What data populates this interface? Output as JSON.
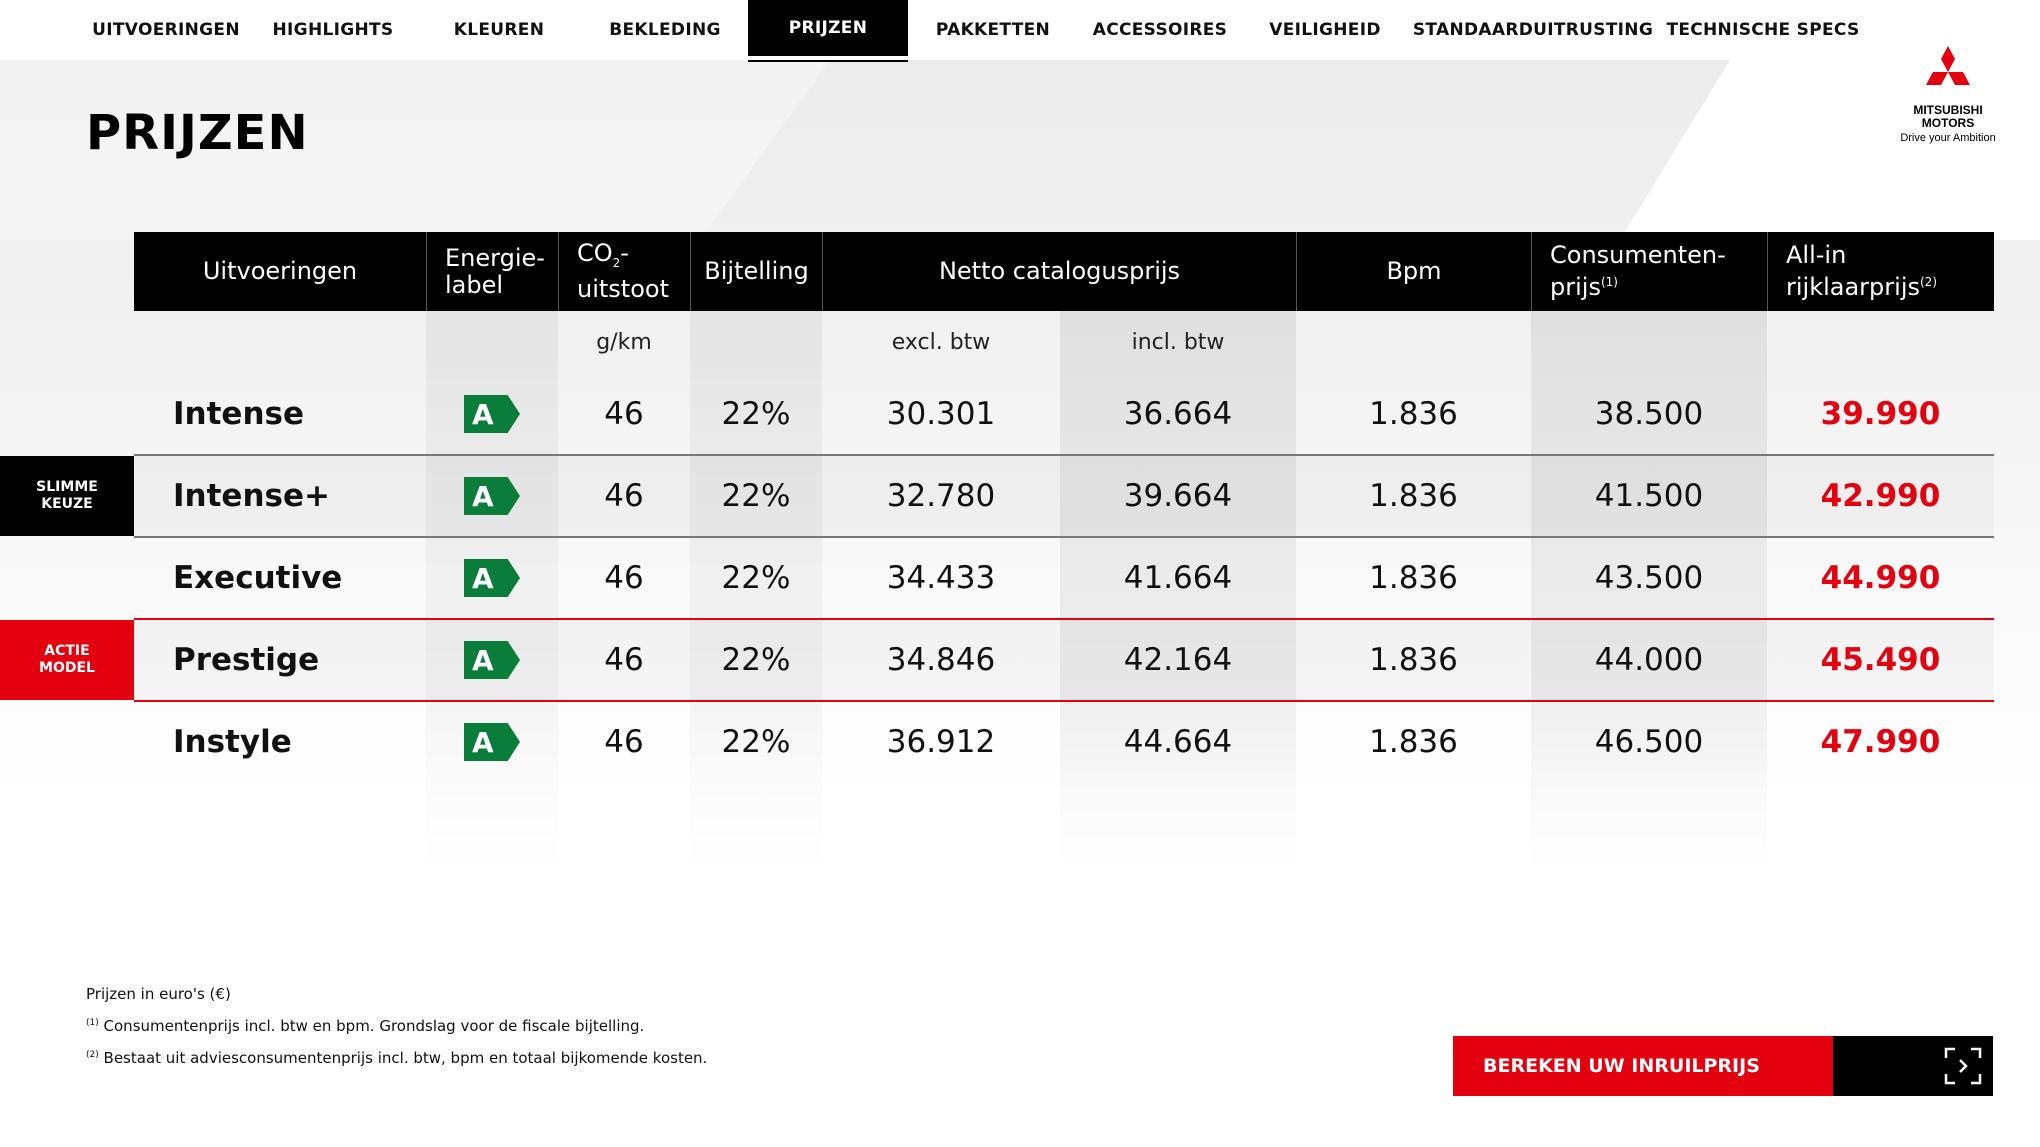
{
  "nav": [
    {
      "label": "UITVOERINGEN"
    },
    {
      "label": "HIGHLIGHTS"
    },
    {
      "label": "KLEUREN"
    },
    {
      "label": "BEKLEDING"
    },
    {
      "label": "PRIJZEN"
    },
    {
      "label": "PAKKETTEN"
    },
    {
      "label": "ACCESSOIRES"
    },
    {
      "label": "VEILIGHEID"
    },
    {
      "label": "STANDAARDUITRUSTING"
    },
    {
      "label": "TECHNISCHE SPECS"
    }
  ],
  "nav_active": "PRIJZEN",
  "logo": {
    "line1": "MITSUBISHI",
    "line2": "MOTORS",
    "tagline": "Drive your Ambition",
    "icon": "three-diamonds-icon",
    "color": "#e3000f"
  },
  "page_title": "PRIJZEN",
  "table": {
    "headers": {
      "uitvoeringen": "Uitvoeringen",
      "energie_l1": "Energie-",
      "energie_l2": "label",
      "co2_l1a": "CO",
      "co2_sub": "2",
      "co2_l1b": "-",
      "co2_l2": "uitstoot",
      "bijtelling": "Bijtelling",
      "netto": "Netto catalogusprijs",
      "bpm": "Bpm",
      "consumenten_l1": "Consumenten-",
      "consumenten_l2": "prijs",
      "consumenten_sup": "(1)",
      "allin_l1": "All-in",
      "allin_l2": "rijklaarprijs",
      "allin_sup": "(2)"
    },
    "subheaders": {
      "co2": "g/km",
      "excl": "excl. btw",
      "incl": "incl. btw"
    },
    "rows": [
      {
        "name": "Intense",
        "label": "A",
        "co2": "46",
        "bijtelling": "22%",
        "excl": "30.301",
        "incl": "36.664",
        "bpm": "1.836",
        "consumenten": "38.500",
        "allin": "39.990"
      },
      {
        "name": "Intense+",
        "label": "A",
        "co2": "46",
        "bijtelling": "22%",
        "excl": "32.780",
        "incl": "39.664",
        "bpm": "1.836",
        "consumenten": "41.500",
        "allin": "42.990"
      },
      {
        "name": "Executive",
        "label": "A",
        "co2": "46",
        "bijtelling": "22%",
        "excl": "34.433",
        "incl": "41.664",
        "bpm": "1.836",
        "consumenten": "43.500",
        "allin": "44.990"
      },
      {
        "name": "Prestige",
        "label": "A",
        "co2": "46",
        "bijtelling": "22%",
        "excl": "34.846",
        "incl": "42.164",
        "bpm": "1.836",
        "consumenten": "44.000",
        "allin": "45.490"
      },
      {
        "name": "Instyle",
        "label": "A",
        "co2": "46",
        "bijtelling": "22%",
        "excl": "36.912",
        "incl": "44.664",
        "bpm": "1.836",
        "consumenten": "46.500",
        "allin": "47.990"
      }
    ],
    "tags": {
      "slimme_l1": "SLIMME",
      "slimme_l2": "KEUZE",
      "actie_l1": "ACTIE",
      "actie_l2": "MODEL"
    }
  },
  "footnotes": {
    "line1": "Prijzen in euro's (€)",
    "sup1": "(1)",
    "line2": "Consumentenprijs incl. btw en bpm. Grondslag voor de fiscale bijtelling.",
    "sup2": "(2)",
    "line3": "Bestaat uit adviesconsumentenprijs incl. btw, bpm en totaal bijkomende kosten."
  },
  "cta": {
    "label": "BEREKEN UW INRUILPRIJS",
    "icon": "fullscreen-expand-icon"
  },
  "colors": {
    "accent_red": "#e3000f",
    "energy_green": "#0b7d3a",
    "header_black": "#000000"
  }
}
